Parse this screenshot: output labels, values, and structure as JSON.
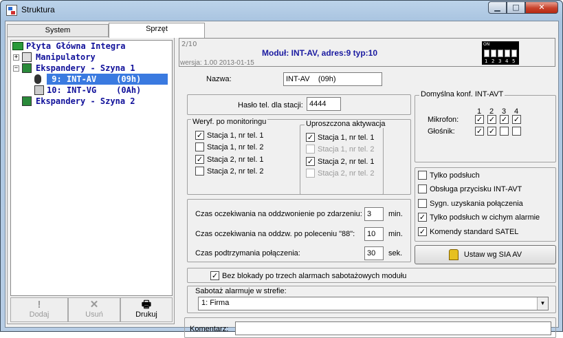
{
  "window": {
    "title": "Struktura",
    "minimize": "▁",
    "maximize": "□",
    "close": "✕"
  },
  "tabs": [
    {
      "label": "System"
    },
    {
      "label": "Sprzęt"
    }
  ],
  "tree": {
    "root": "Płyta Główna Integra",
    "items": [
      "Manipulatory",
      "Ekspandery - Szyna 1",
      " 9: INT-AV    (09h)",
      "10: INT-VG    (0Ah)",
      "Ekspandery - Szyna 2"
    ]
  },
  "bottom_buttons": [
    {
      "label": "Dodaj",
      "icon": "!"
    },
    {
      "label": "Usuń",
      "icon": "✕"
    },
    {
      "label": "Drukuj",
      "icon": "🖶"
    }
  ],
  "header": {
    "pager": "2/10",
    "module": "Moduł: INT-AV, adres:9 typ:10",
    "version": "wersja: 1.00 2013-01-15",
    "dip_on": "ON",
    "dip_numbers": [
      "1",
      "2",
      "3",
      "4",
      "5"
    ]
  },
  "form": {
    "name_label": "Nazwa:",
    "name_value": "INT-AV    (09h)",
    "password_label": "Hasło tel. dla stacji:",
    "password_value": "4444",
    "verif_title": "Weryf. po monitoringu",
    "verif_items": [
      "Stacja 1, nr tel. 1",
      "Stacja 1, nr tel. 2",
      "Stacja 2, nr tel. 1",
      "Stacja 2, nr tel. 2"
    ],
    "verif_checked": [
      true,
      false,
      true,
      false
    ],
    "simple_title": "Uproszczona aktywacja",
    "simple_items": [
      "Stacja 1, nr tel. 1",
      "Stacja 1, nr tel. 2",
      "Stacja 2, nr tel. 1",
      "Stacja 2, nr tel. 2"
    ],
    "simple_checked": [
      true,
      false,
      true,
      false
    ],
    "simple_disabled": [
      false,
      true,
      false,
      true
    ],
    "wait_event_label": "Czas oczekiwania na oddzwonienie po zdarzeniu:",
    "wait_event_value": "3",
    "wait_event_unit": "min.",
    "wait_88_label": "Czas oczekiwania na oddzw. po poleceniu \"88\":",
    "wait_88_value": "10",
    "wait_88_unit": "min.",
    "hold_label": "Czas podtrzymania połączenia:",
    "hold_value": "30",
    "hold_unit": "sek.",
    "no_block_label": "Bez blokady po trzech alarmach sabotażowych modułu",
    "no_block_checked": true,
    "tamper_label": "Sabotaż alarmuje w strefie:",
    "tamper_value": "1: Firma",
    "comment_label": "Komentarz:",
    "comment_value": ""
  },
  "avt": {
    "title": "Domyślna konf. INT-AVT",
    "cols": [
      "1",
      "2",
      "3",
      "4"
    ],
    "mic_label": "Mikrofon:",
    "mic_checked": [
      true,
      true,
      true,
      true
    ],
    "spk_label": "Głośnik:",
    "spk_checked": [
      true,
      true,
      false,
      false
    ]
  },
  "options": {
    "items": [
      "Tylko podsłuch",
      "Obsługa przycisku INT-AVT",
      "Sygn. uzyskania połączenia",
      "Tylko podsłuch w cichym alarmie",
      "Komendy standard SATEL"
    ],
    "checked": [
      false,
      false,
      false,
      true,
      true
    ]
  },
  "sia_button": "Ustaw wg SIA AV"
}
